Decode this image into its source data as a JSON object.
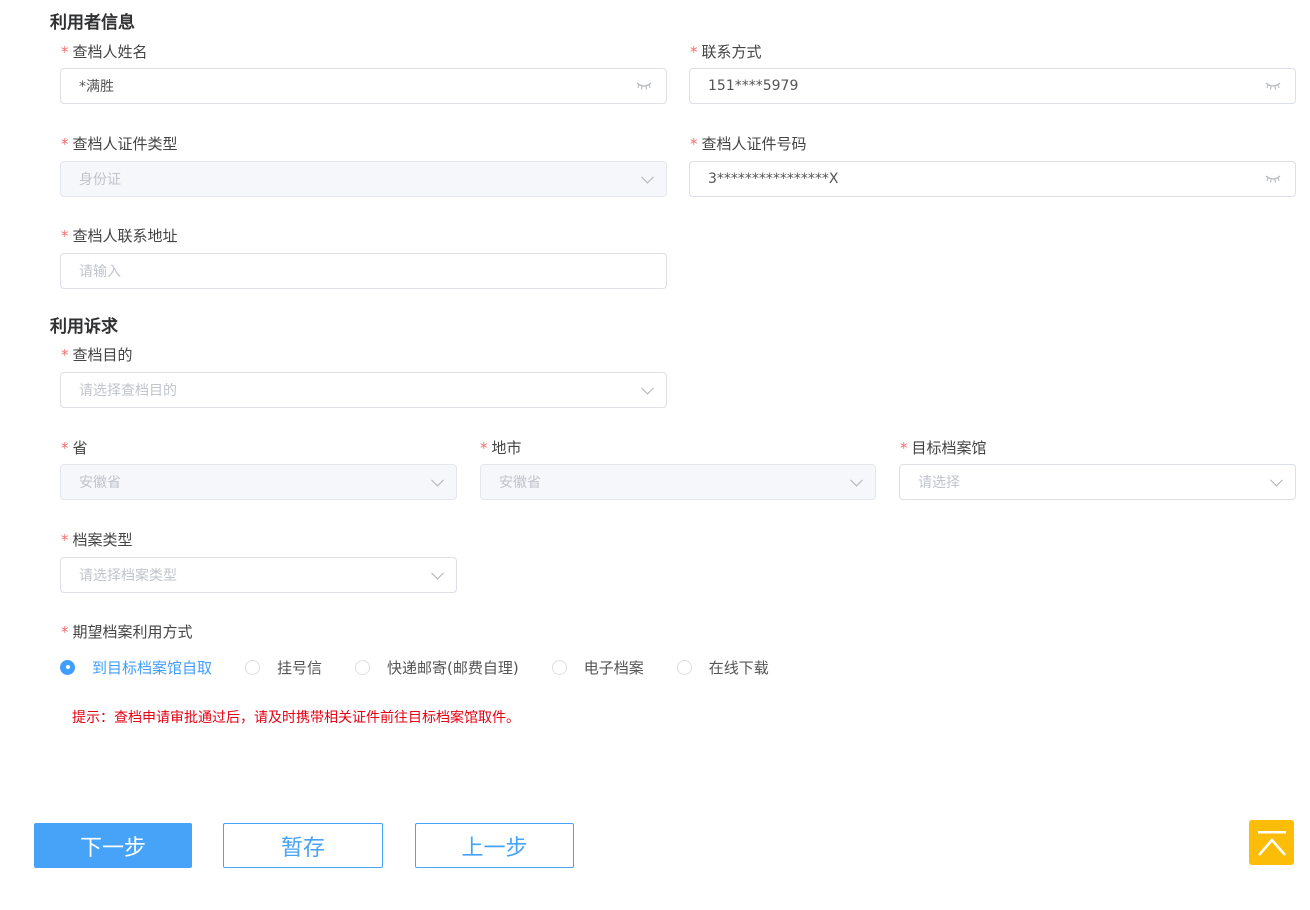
{
  "sections": {
    "user_info": "利用者信息",
    "request": "利用诉求"
  },
  "required_mark": "*",
  "fields": {
    "name": {
      "label": "查档人姓名",
      "value": "*满胜",
      "icon": "eye-closed-icon"
    },
    "contact": {
      "label": "联系方式",
      "value": "151****5979",
      "icon": "eye-closed-icon"
    },
    "id_type": {
      "label": "查档人证件类型",
      "value": "身份证",
      "disabled": true
    },
    "id_number": {
      "label": "查档人证件号码",
      "value": "3****************X",
      "icon": "eye-closed-icon"
    },
    "address": {
      "label": "查档人联系地址",
      "placeholder": "请输入"
    },
    "purpose": {
      "label": "查档目的",
      "placeholder": "请选择查档目的"
    },
    "province": {
      "label": "省",
      "value": "安徽省",
      "disabled": true
    },
    "city": {
      "label": "地市",
      "value": "安徽省",
      "disabled": true
    },
    "archive": {
      "label": "目标档案馆",
      "placeholder": "请选择"
    },
    "archive_type": {
      "label": "档案类型",
      "placeholder": "请选择档案类型"
    },
    "method": {
      "label": "期望档案利用方式",
      "options": [
        "到目标档案馆自取",
        "挂号信",
        "快递邮寄(邮费自理)",
        "电子档案",
        "在线下载"
      ],
      "selected": "到目标档案馆自取"
    }
  },
  "tip": "提示：查档申请审批通过后，请及时携带相关证件前往目标档案馆取件。",
  "buttons": {
    "next": "下一步",
    "save": "暂存",
    "prev": "上一步"
  },
  "back_to_top_icon": "back-to-top-icon",
  "colors": {
    "primary": "#409eff",
    "button": "#46a3f7",
    "required": "#f56c6c",
    "tip": "#e60012",
    "back_to_top": "#fbbd08"
  }
}
